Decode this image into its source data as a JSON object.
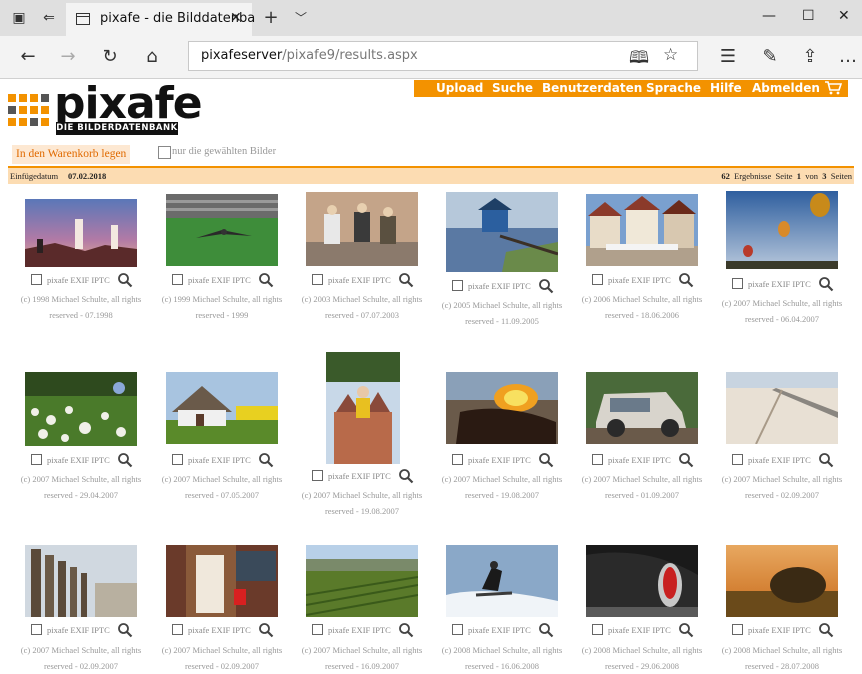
{
  "browser": {
    "tab_title": "pixafe - die Bilddatenba",
    "url_host": "pixafeserver",
    "url_path": "/pixafe9/results.aspx"
  },
  "logo": {
    "word": "pixafe",
    "tagline": "DIE BILDERDATENBANK"
  },
  "menu": {
    "items": [
      {
        "label": "Upload"
      },
      {
        "label": "Suche"
      },
      {
        "label": "Benutzerdaten"
      },
      {
        "label": "Sprache"
      },
      {
        "label": "Hilfe"
      },
      {
        "label": "Abmelden"
      }
    ]
  },
  "actions": {
    "cart_button": "In den Warenkorb legen",
    "selected_only_label": "nur die gewählten Bilder"
  },
  "info": {
    "date_label": "Einfügedatum",
    "date_value": "07.02.2018",
    "results_count": "62",
    "results_label": "Ergebnisse",
    "page_label": "Seite",
    "page_current": "1",
    "of_label": "von",
    "page_total": "3",
    "pages_label": "Seiten"
  },
  "colors": {
    "accent": "#f39200",
    "info_bg": "#fcdcb2"
  },
  "item_controls": "pixafe EXIF IPTC",
  "images": [
    {
      "scene": "sunset-people",
      "caption_1": "(c) 1998 Michael Schulte, all rights",
      "caption_2": "reserved - 07.1998"
    },
    {
      "scene": "bird-field",
      "caption_1": "(c) 1999 Michael Schulte, all rights",
      "caption_2": "reserved - 1999"
    },
    {
      "scene": "men-bench",
      "caption_1": "(c) 2003 Michael Schulte, all rights",
      "caption_2": "reserved - 07.07.2003"
    },
    {
      "scene": "boathouse",
      "caption_1": "(c) 2005 Michael Schulte, all rights",
      "caption_2": "reserved - 11.09.2005"
    },
    {
      "scene": "half-timbered",
      "caption_1": "(c) 2006 Michael Schulte, all rights",
      "caption_2": "reserved - 18.06.2006"
    },
    {
      "scene": "balloons",
      "caption_1": "(c) 2007 Michael Schulte, all rights",
      "caption_2": "reserved - 06.04.2007"
    },
    {
      "scene": "dandelions",
      "caption_1": "(c) 2007 Michael Schulte, all rights",
      "caption_2": "reserved - 29.04.2007"
    },
    {
      "scene": "thatched-house",
      "caption_1": "(c) 2007 Michael Schulte, all rights",
      "caption_2": "reserved - 07.05.2007"
    },
    {
      "scene": "swing-castle",
      "caption_1": "(c) 2007 Michael Schulte, all rights",
      "caption_2": "reserved - 19.08.2007"
    },
    {
      "scene": "fire-hair",
      "caption_1": "(c) 2007 Michael Schulte, all rights",
      "caption_2": "reserved - 19.08.2007"
    },
    {
      "scene": "old-car",
      "caption_1": "(c) 2007 Michael Schulte, all rights",
      "caption_2": "reserved - 01.09.2007"
    },
    {
      "scene": "beach-tracks",
      "caption_1": "(c) 2007 Michael Schulte, all rights",
      "caption_2": "reserved - 02.09.2007"
    },
    {
      "scene": "groynes",
      "caption_1": "(c) 2007 Michael Schulte, all rights",
      "caption_2": "reserved - 02.09.2007"
    },
    {
      "scene": "house-door",
      "caption_1": "(c) 2007 Michael Schulte, all rights",
      "caption_2": "reserved - 02.09.2007"
    },
    {
      "scene": "vineyard",
      "caption_1": "(c) 2007 Michael Schulte, all rights",
      "caption_2": "reserved - 16.09.2007"
    },
    {
      "scene": "jetski",
      "caption_1": "(c) 2008 Michael Schulte, all rights",
      "caption_2": "reserved - 16.06.2008"
    },
    {
      "scene": "car-taillight",
      "caption_1": "(c) 2008 Michael Schulte, all rights",
      "caption_2": "reserved - 29.06.2008"
    },
    {
      "scene": "hay-bale-sunset",
      "caption_1": "(c) 2008 Michael Schulte, all rights",
      "caption_2": "reserved - 28.07.2008"
    }
  ]
}
